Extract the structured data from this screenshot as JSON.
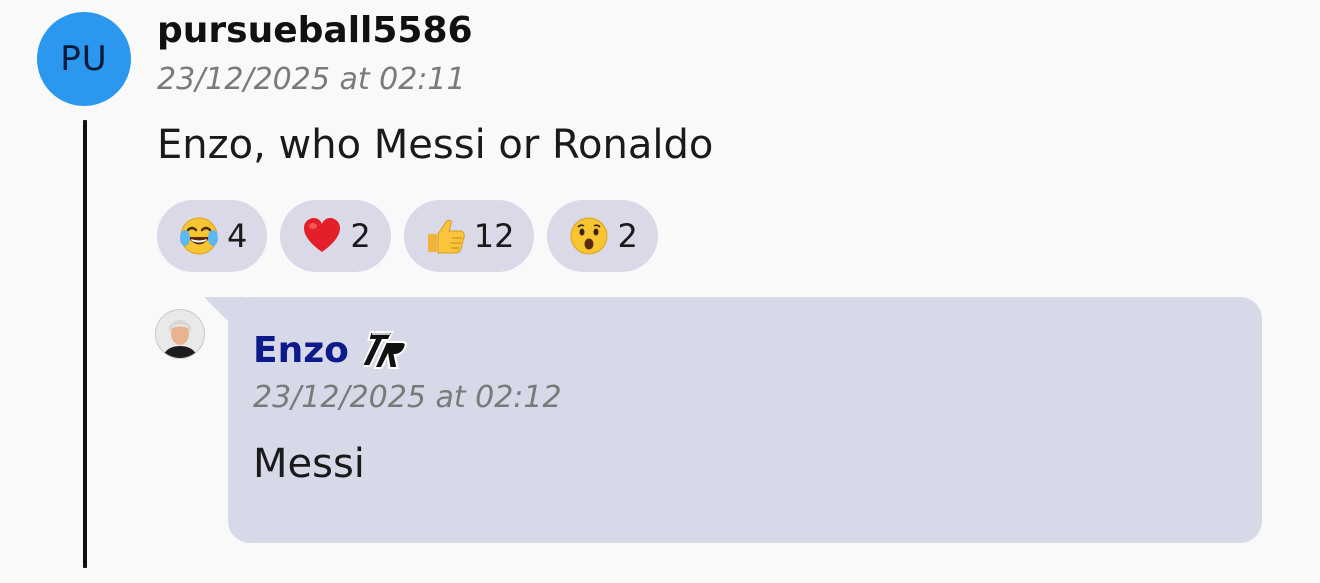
{
  "colors": {
    "avatar_bg": "#2b97ee",
    "reply_bubble_bg": "#d8d9e8",
    "reaction_bg": "#d9d9e8",
    "reply_name_color": "#0d1a8c",
    "thread_line": "#111111"
  },
  "comment": {
    "avatar_initials": "PU",
    "username": "pursueball5586",
    "timestamp": "23/12/2025 at 02:11",
    "message": "Enzo, who Messi or Ronaldo",
    "reactions": [
      {
        "icon": "tears-of-joy-emoji-icon",
        "count": "4"
      },
      {
        "icon": "red-heart-emoji-icon",
        "count": "2"
      },
      {
        "icon": "thumbs-up-emoji-icon",
        "count": "12"
      },
      {
        "icon": "surprised-face-emoji-icon",
        "count": "2"
      }
    ]
  },
  "reply": {
    "avatar": "profile-photo-avatar",
    "username": "Enzo",
    "badge_icon": "tr-badge-icon",
    "timestamp": "23/12/2025 at 02:12",
    "message": "Messi"
  }
}
